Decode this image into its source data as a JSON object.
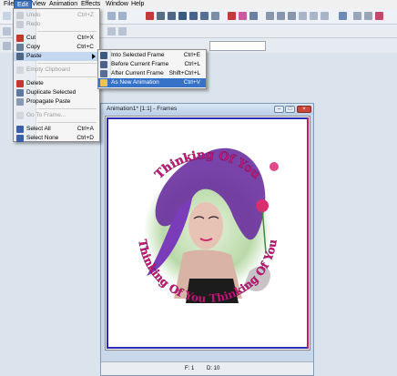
{
  "menubar": {
    "items": [
      "File",
      "Edit",
      "View",
      "Animation",
      "Effects",
      "Window",
      "Help"
    ]
  },
  "edit_menu": {
    "items": [
      {
        "label": "Undo",
        "shortcut": "Ctrl+Z",
        "disabled": true
      },
      {
        "label": "Redo",
        "shortcut": "",
        "disabled": true
      },
      {
        "label": "Cut",
        "shortcut": "Ctrl+X",
        "disabled": false
      },
      {
        "label": "Copy",
        "shortcut": "Ctrl+C",
        "disabled": false
      },
      {
        "label": "Paste",
        "shortcut": "",
        "disabled": false
      },
      {
        "label": "Empty Clipboard",
        "shortcut": "",
        "disabled": true
      },
      {
        "label": "Delete",
        "shortcut": "",
        "disabled": false
      },
      {
        "label": "Duplicate Selected",
        "shortcut": "",
        "disabled": false
      },
      {
        "label": "Propagate Paste",
        "shortcut": "",
        "disabled": false
      },
      {
        "label": "Go To Frame...",
        "shortcut": "",
        "disabled": true
      },
      {
        "label": "Select All",
        "shortcut": "Ctrl+A",
        "disabled": false
      },
      {
        "label": "Select None",
        "shortcut": "Ctrl+D",
        "disabled": false
      }
    ]
  },
  "paste_submenu": {
    "items": [
      {
        "label": "Into Selected Frame",
        "shortcut": "Ctrl+E"
      },
      {
        "label": "Before Current Frame",
        "shortcut": "Ctrl+L"
      },
      {
        "label": "After Current Frame",
        "shortcut": "Shift+Ctrl+L"
      },
      {
        "label": "As New Animation",
        "shortcut": "Ctrl+V"
      }
    ]
  },
  "frame_window": {
    "title": "Animation1* [1:1] - Frames",
    "status_frame": "F: 1",
    "status_delay": "D: 10",
    "top_text": "Thinking Of You",
    "bottom_text": "Thinking Of You Thinking Of You"
  },
  "colors": {
    "accent": "#3572c8",
    "border_blue": "#2a2ab8",
    "border_magenta": "#c0186a"
  }
}
